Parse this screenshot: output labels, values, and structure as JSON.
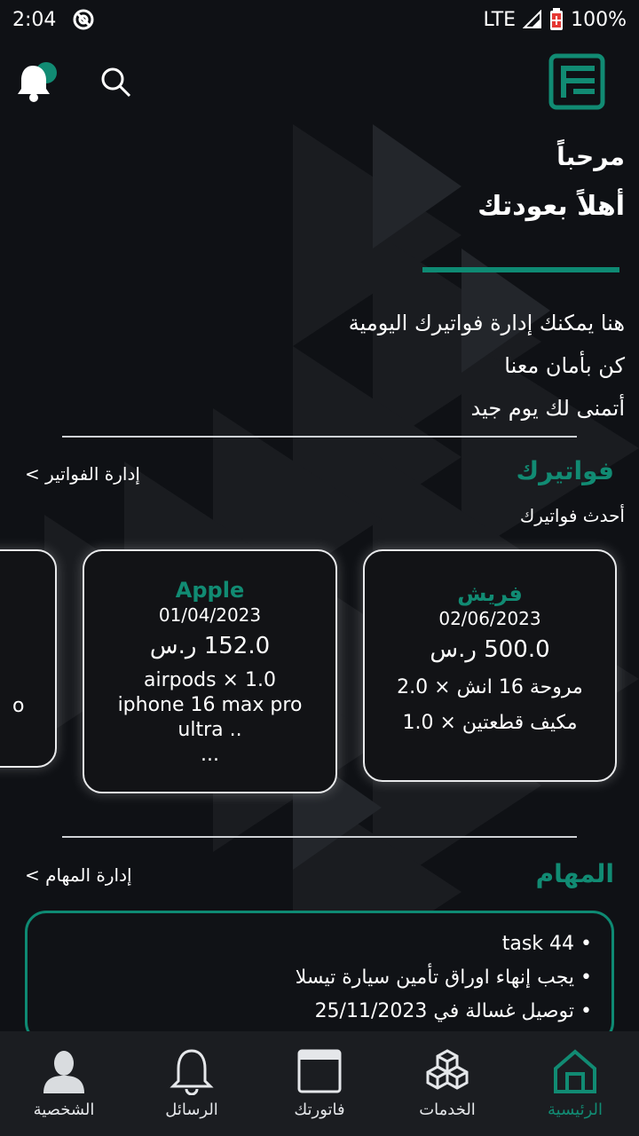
{
  "status": {
    "time": "2:04",
    "network": "LTE",
    "battery": "100%"
  },
  "welcome": {
    "greeting": "مرحباً",
    "title": "أهلاً بعودتك"
  },
  "intro": [
    "هنا يمكنك إدارة فواتيرك اليومية",
    "كن بأمان معنا",
    "أتمنى لك يوم جيد"
  ],
  "invoices": {
    "section_title": "فواتيرك",
    "manage_link": "إدارة الفواتير >",
    "subtitle": "أحدث فواتيرك",
    "cards": [
      {
        "store": "فريش",
        "date": "02/06/2023",
        "amount": "500.0 ر.س",
        "items": [
          "مروحة 16 انش × 2.0",
          "مكيف قطعتين × 1.0"
        ]
      },
      {
        "store": "Apple",
        "date": "01/04/2023",
        "amount": "152.0 ر.س",
        "items": [
          "airpods × 1.0",
          "iphone 16 max pro",
          "ultra ..",
          "..."
        ]
      },
      {
        "partial_text": "o"
      }
    ]
  },
  "tasks": {
    "section_title": "المهام",
    "manage_link": "إدارة المهام >",
    "items": [
      "task 44",
      "يجب إنهاء اوراق تأمين سيارة تيسلا",
      "توصيل غسالة في 25/11/2023"
    ]
  },
  "nav": [
    {
      "label": "الرئيسية",
      "icon": "home-icon",
      "active": true
    },
    {
      "label": "الخدمات",
      "icon": "cubes-icon"
    },
    {
      "label": "فاتورتك",
      "icon": "invoice-icon"
    },
    {
      "label": "الرسائل",
      "icon": "bell-icon"
    },
    {
      "label": "الشخصية",
      "icon": "person-icon"
    }
  ],
  "colors": {
    "accent": "#118b73",
    "background": "#0f1115",
    "navbar": "#1b1d21"
  }
}
